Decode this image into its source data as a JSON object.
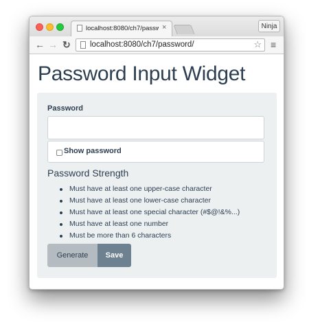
{
  "browser": {
    "tab_title": "localhost:8080/ch7/passwo",
    "tab_close": "×",
    "profile_label": "Ninja",
    "url_host": "localhost",
    "url_rest": ":8080/ch7/password/",
    "icons": {
      "back": "back-arrow-icon",
      "forward": "forward-arrow-icon",
      "reload": "reload-icon",
      "bookmark": "star-icon",
      "menu": "hamburger-menu-icon"
    }
  },
  "page": {
    "title": "Password Input Widget",
    "password_label": "Password",
    "password_value": "",
    "show_password_label": "Show password",
    "show_password_checked": false,
    "strength_title": "Password Strength",
    "rules": [
      "Must have at least one upper-case character",
      "Must have at least one lower-case character",
      "Must have at least one special character (#$@!&%...)",
      "Must have at least one number",
      "Must be more than 6 characters"
    ],
    "generate_label": "Generate",
    "save_label": "Save"
  },
  "colors": {
    "heading": "#2c3e50",
    "panel_bg": "#ecf0f1",
    "generate_bg": "#b4bcc2",
    "save_bg": "#6d8190"
  }
}
